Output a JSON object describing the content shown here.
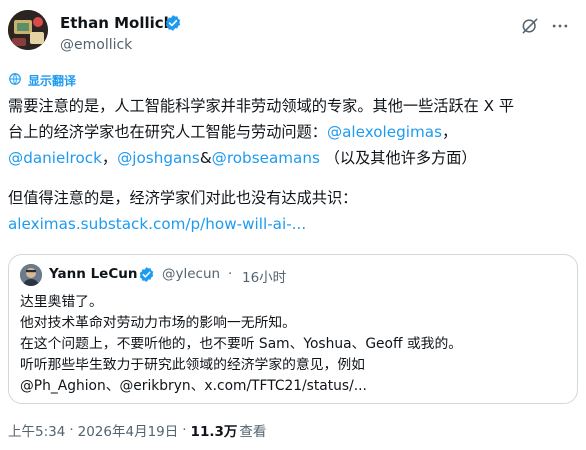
{
  "author": {
    "name": "Ethan Mollick",
    "handle": "@emollick"
  },
  "translate_label": "显示翻译",
  "tweet": {
    "line1": "需要注意的是，人工智能科学家并非劳动领域的专家。其他一些活跃在 X 平",
    "line2_text": "台上的经济学家也在研究人工智能与劳动问题：",
    "mention_alexolegimas": "@alexolegimas",
    "comma1": "，",
    "mention_danielrock": "@danielrock",
    "comma2": "，",
    "mention_joshgans": "@joshgans",
    "ampersand": "&",
    "mention_robseamans": "@robseamans",
    "line3_tail": " （以及其他许多方面）",
    "line4": "但值得注意的是，经济学家们对此也没有达成共识：",
    "link": "aleximas.substack.com/p/how-will-ai-..."
  },
  "quote": {
    "name": "Yann LeCun",
    "handle": "@ylecun",
    "dot": "·",
    "time": "16小时",
    "lines": [
      "达里奥错了。",
      "他对技术革命对劳动力市场的影响一无所知。",
      "在这个问题上，不要听他的，也不要听 Sam、Yoshua、Geoff 或我的。",
      "听听那些毕生致力于研究此领域的经济学家的意见，例如",
      "@Ph_Aghion、@erikbryn、x.com/TFTC21/status/..."
    ]
  },
  "meta": {
    "time": "上午5:34",
    "sep": "·",
    "date": "2026年4月19日",
    "views_count": "11.3万",
    "views_label": "查看"
  },
  "colors": {
    "accent": "#1d9bf0",
    "text": "#0f1419",
    "muted": "#536471",
    "border": "#cfd9de"
  },
  "icons": {
    "verified": "verified-badge-icon",
    "grok": "grok-icon",
    "more": "more-icon",
    "translate": "translate-icon"
  }
}
